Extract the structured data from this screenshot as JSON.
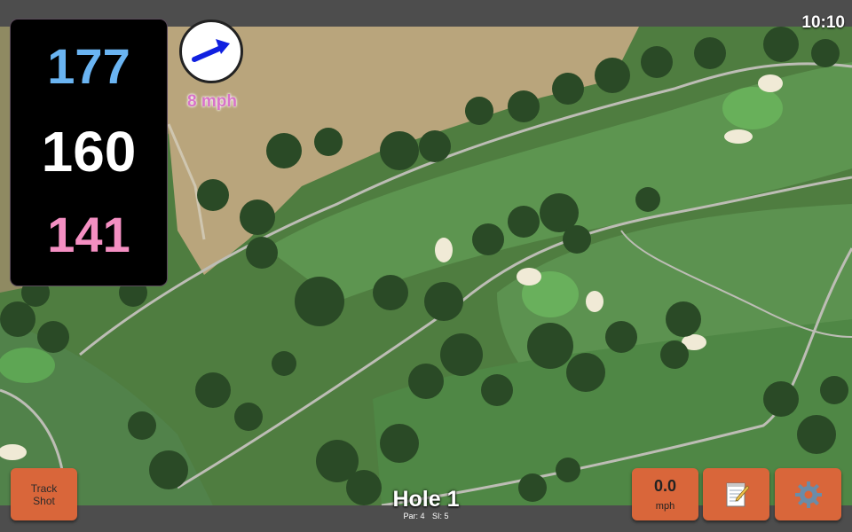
{
  "status": {
    "time": "10:10"
  },
  "distances": {
    "back": "177",
    "middle": "160",
    "front": "141"
  },
  "wind": {
    "speed_label": "8 mph",
    "direction_icon": "arrow-right-icon"
  },
  "hole": {
    "title": "Hole 1",
    "par": "Par: 4",
    "si": "SI: 5"
  },
  "buttons": {
    "track_shot_line1": "Track",
    "track_shot_line2": "Shot",
    "wind_value": "0.0",
    "wind_unit": "mph",
    "notes_icon": "notepad-icon",
    "settings_icon": "gear-icon"
  },
  "colors": {
    "back": "#6ab4f2",
    "middle": "#ffffff",
    "front": "#f48fc2",
    "button": "#d9663a",
    "wind_text": "#d873c9"
  }
}
